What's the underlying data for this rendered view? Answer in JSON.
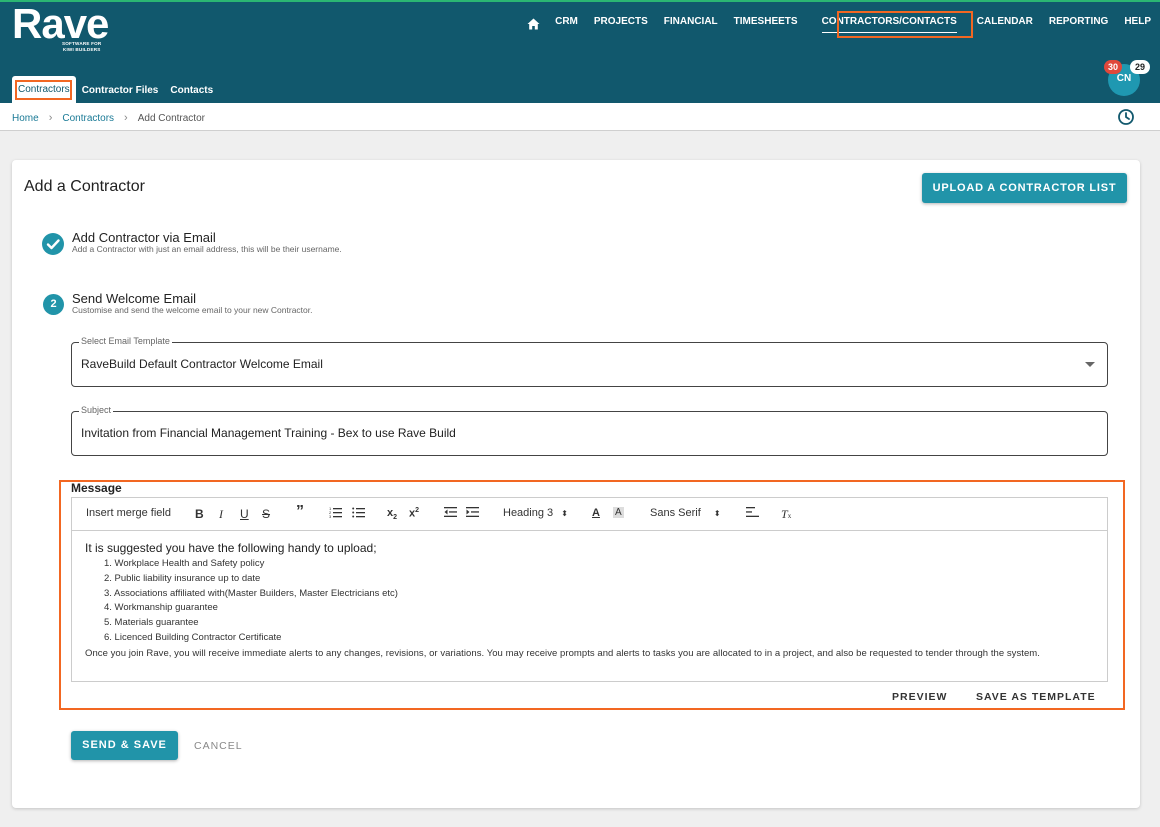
{
  "brand": {
    "name": "Rave",
    "tagline_line1": "SOFTWARE FOR",
    "tagline_line2": "KIWI BUILDERS"
  },
  "colors": {
    "header": "#11586d",
    "accent": "#2194a9",
    "highlight": "#f26722",
    "topline": "#2bb673"
  },
  "nav": {
    "home_icon": "home-icon",
    "items": [
      "CRM",
      "PROJECTS",
      "FINANCIAL",
      "TIMESHEETS",
      "CONTRACTORS/CONTACTS",
      "CALENDAR",
      "REPORTING",
      "HELP"
    ],
    "active": "CONTRACTORS/CONTACTS"
  },
  "user": {
    "initials": "CN",
    "badge_red": "30",
    "badge_white": "29"
  },
  "subnav": {
    "items": [
      "Contractors",
      "Contractor Files",
      "Contacts"
    ],
    "active": "Contractors"
  },
  "breadcrumb": {
    "items": [
      "Home",
      "Contractors",
      "Add Contractor"
    ]
  },
  "page": {
    "title": "Add a Contractor",
    "upload_button": "UPLOAD A CONTRACTOR LIST"
  },
  "steps": [
    {
      "number": "",
      "status": "complete",
      "title": "Add Contractor via Email",
      "subtitle": "Add a Contractor with just an email address, this will be their username."
    },
    {
      "number": "2",
      "status": "active",
      "title": "Send Welcome Email",
      "subtitle": "Customise and send the welcome email to your new Contractor."
    }
  ],
  "form": {
    "template_label": "Select Email Template",
    "template_value": "RaveBuild Default Contractor Welcome Email",
    "subject_label": "Subject",
    "subject_value": "Invitation from Financial Management Training - Bex to use Rave Build",
    "message_label": "Message"
  },
  "toolbar": {
    "merge_field": "Insert merge field",
    "heading": "Heading 3",
    "font": "Sans Serif"
  },
  "message": {
    "intro": "It is suggested you have the following handy to upload;",
    "items": [
      "1. Workplace Health and Safety policy",
      "2. Public liability insurance up to date",
      "3. Associations affiliated with(Master Builders, Master Electricians etc)",
      "4. Workmanship guarantee",
      "5. Materials guarantee",
      "6. Licenced Building Contractor Certificate"
    ],
    "outro": "Once you join Rave, you will receive immediate alerts to any changes, revisions, or variations. You may receive prompts and alerts to tasks you are allocated to in a project, and also be requested to tender through the system."
  },
  "actions": {
    "preview": "PREVIEW",
    "save_template": "SAVE AS TEMPLATE",
    "send_save": "SEND & SAVE",
    "cancel": "CANCEL"
  }
}
